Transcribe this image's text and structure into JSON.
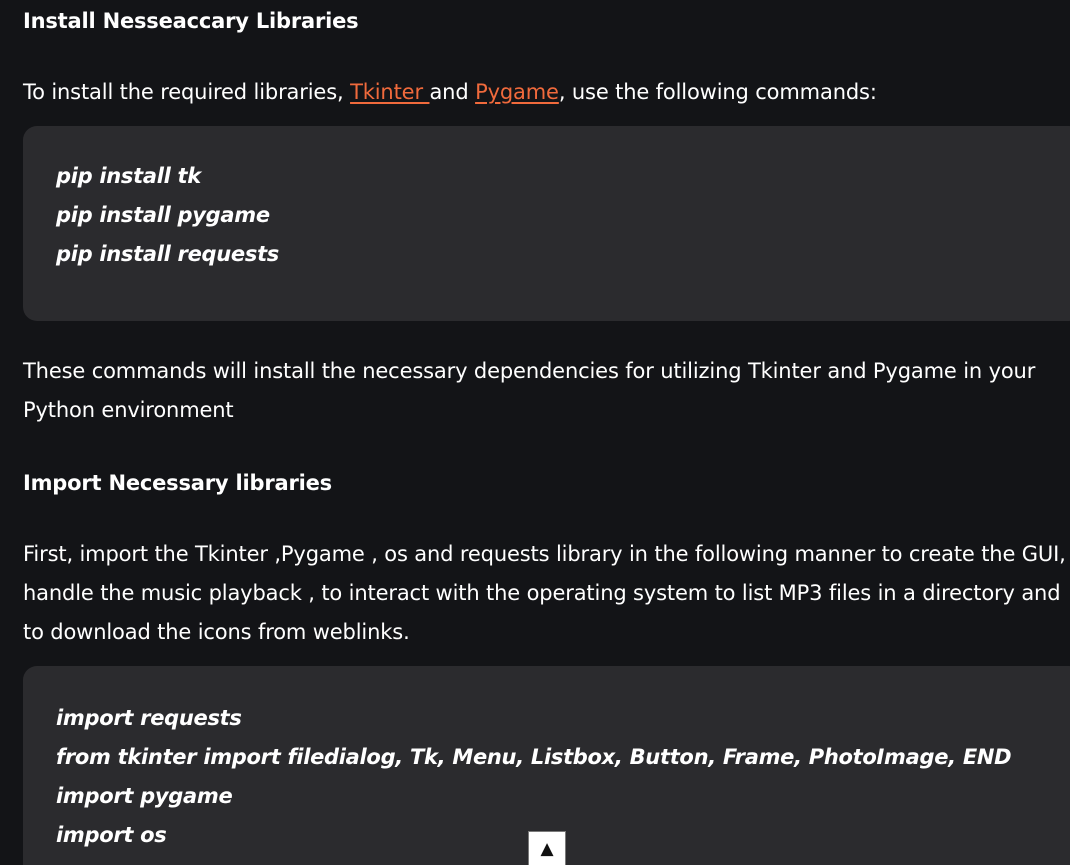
{
  "section1": {
    "heading": "Install Nesseaccary Libraries",
    "intro_before": "To install the required libraries, ",
    "link1": "Tkinter ",
    "intro_middle": "and ",
    "link2": "Pygame",
    "intro_after": ", use the following commands:",
    "code": [
      "pip install tk",
      "pip install pygame",
      "pip install requests"
    ],
    "outro": "These commands will install the necessary dependencies for utilizing Tkinter and Pygame in your Python environment"
  },
  "section2": {
    "heading": "Import Necessary libraries",
    "description": "First, import the Tkinter ,Pygame , os and requests library in the following manner to create the GUI, handle the music playback , to interact with the operating system to list MP3 files in a directory and to download the icons from weblinks.",
    "code": [
      "import requests",
      "from tkinter import filedialog, Tk, Menu, Listbox, Button, Frame, PhotoImage, END",
      "import pygame",
      "import os"
    ]
  },
  "scroll_top_button": {
    "glyph": "▲"
  },
  "colors": {
    "background": "#131417",
    "code_background": "#2b2b2e",
    "link": "#f06a3c",
    "text": "#ffffff"
  }
}
